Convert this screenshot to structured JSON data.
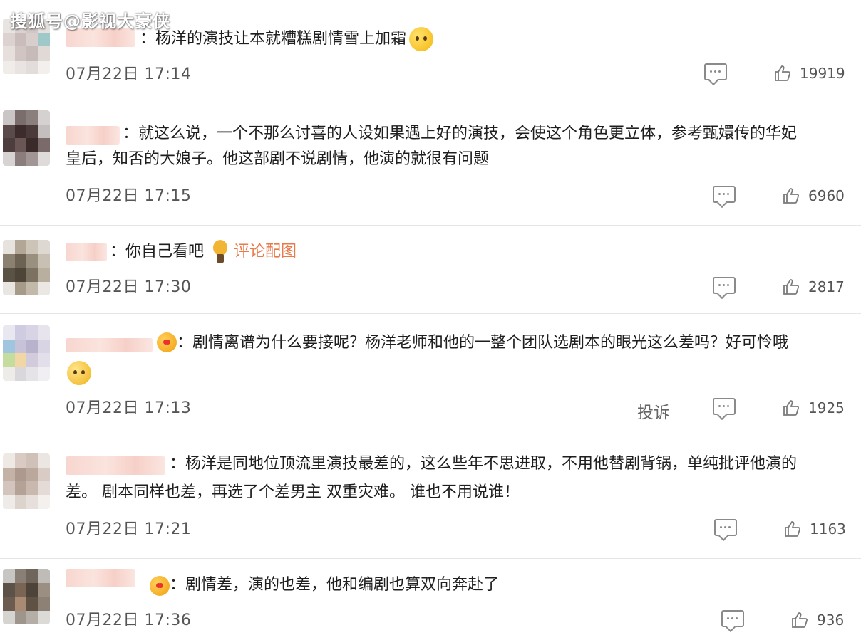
{
  "watermark": "搜狐号@影视大豪侠",
  "comments": [
    {
      "text": "：杨洋的演技让本就糟糕剧情雪上加霜",
      "time": "07月22日 17:14",
      "likes": "19919",
      "emoji": "smirk-face-emoji"
    },
    {
      "text": "：就这么说，一个不那么讨喜的人设如果遇上好的演技，会使这个角色更立体，参考甄嬛传的华妃",
      "text2": "皇后，知否的大娘子。他这部剧不说剧情，他演的就很有问题",
      "time": "07月22日 17:15",
      "likes": "6960"
    },
    {
      "text": "：你自己看吧",
      "link": "评论配图",
      "time": "07月22日 17:30",
      "likes": "2817",
      "emoji": "lightbulb-emoji"
    },
    {
      "text": "：剧情离谱为什么要接呢？杨洋老师和他的一整个团队选剧本的眼光这么差吗？好可怜哦",
      "time": "07月22日 17:13",
      "likes": "1925",
      "report": "投诉",
      "emoji": "pleading-face-emoji"
    },
    {
      "text": "：杨洋是同地位顶流里演技最差的，这么些年不思进取，不用他替剧背锅，单纯批评他演的",
      "text2": "差。 剧本同样也差，再选了个差男主 双重灾难。 谁也不用说谁！",
      "time": "07月22日 17:21",
      "likes": "1163"
    },
    {
      "text": "：剧情差，演的也差，他和编剧也算双向奔赴了",
      "time": "07月22日 17:36",
      "likes": "936"
    }
  ],
  "colors": {
    "link": "#e8794a",
    "name_blur": "#f7d6cf",
    "icon": "#8a8a8a"
  }
}
